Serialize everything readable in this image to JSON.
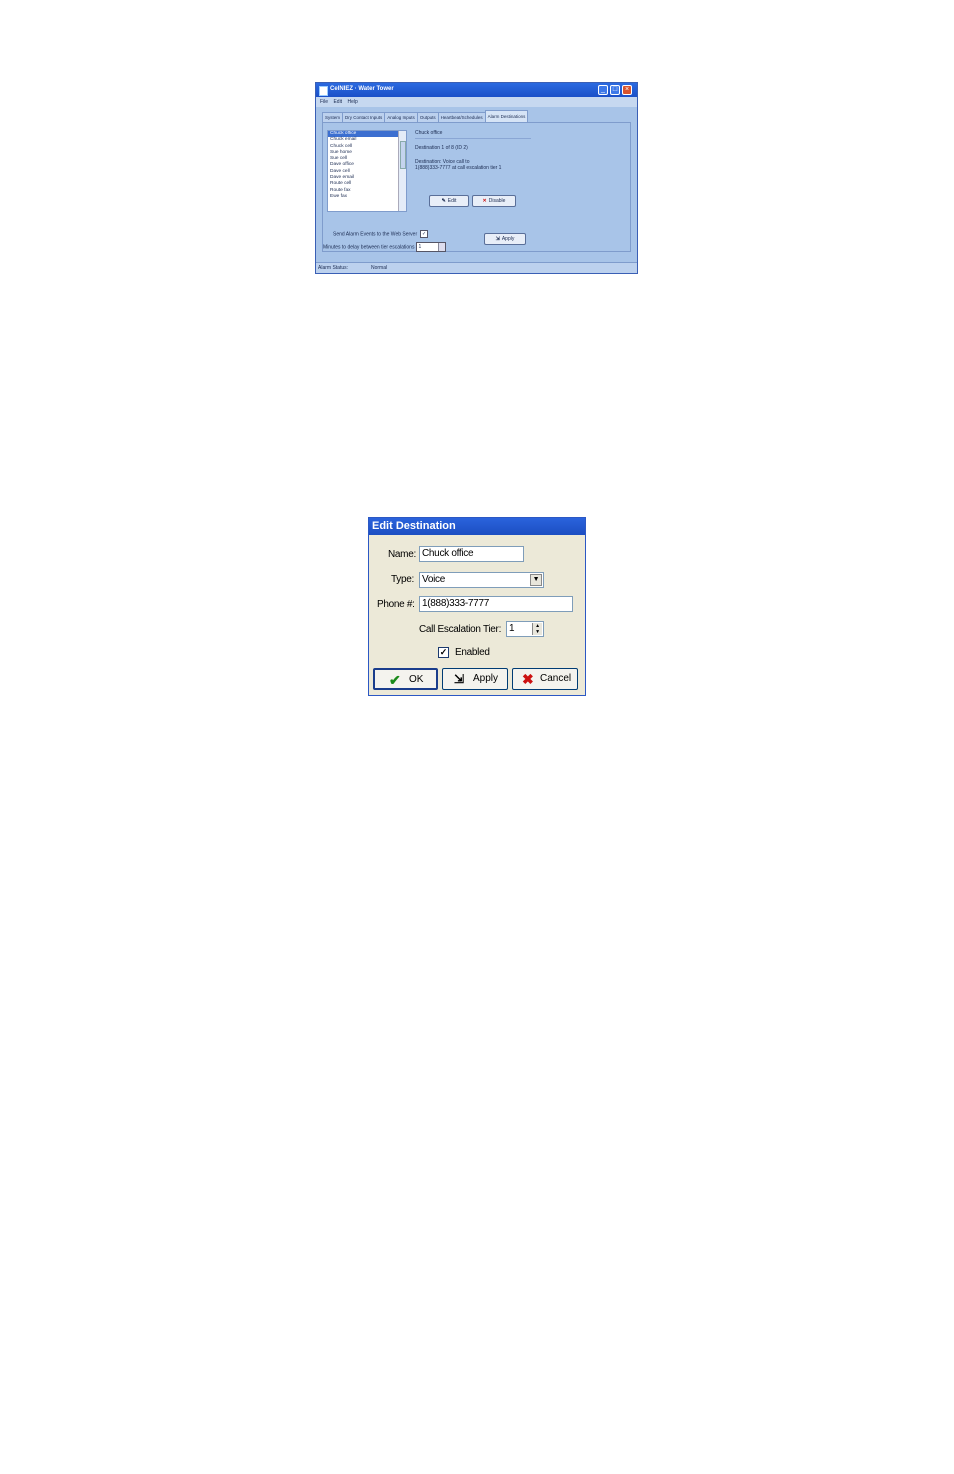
{
  "main_window": {
    "title": "CelNIEZ  ·  Water Tower",
    "title_buttons": [
      "minimize-icon",
      "maximize-icon",
      "close-icon"
    ],
    "menu": [
      "File",
      "Edit",
      "Help"
    ],
    "tabs": [
      "System",
      "Dry Contact Inputs",
      "Analog Inputs",
      "Outputs",
      "Heartbeat/Schedules",
      "Alarm Destinations"
    ],
    "active_tab": "Alarm Destinations",
    "destinations": [
      "Chuck office",
      "Chuck email",
      "Chuck cell",
      "Sue home",
      "Sue cell",
      "Dave office",
      "Dave cell",
      "Dave email",
      "Route cell",
      "Route fax",
      "Ewe fax"
    ],
    "selected_destination": "Chuck office",
    "detail": {
      "name": "Chuck office",
      "position": "Destination 1 of 8 (ID 2)",
      "line1": "Destination: Voice call to",
      "line2": "1(888)333-7777 at call escalation tier 1"
    },
    "edit_button": "Edit",
    "disable_button": "Disable",
    "send_alarm_label": "Send Alarm Events to the Web Server",
    "send_alarm_checked": true,
    "minutes_label": "Minutes to delay between tier escalations",
    "minutes_value": "1",
    "apply_button": "Apply",
    "status": {
      "left": "Alarm Status:",
      "right": "Normal"
    }
  },
  "dialog": {
    "title": "Edit Destination",
    "name_label": "Name:",
    "name_value": "Chuck office",
    "type_label": "Type:",
    "type_value": "Voice",
    "phone_label": "Phone #:",
    "phone_value": "1(888)333-7777",
    "tier_label": "Call Escalation Tier:",
    "tier_value": "1",
    "enabled_label": "Enabled",
    "enabled_checked": true,
    "ok_button": "OK",
    "apply_button": "Apply",
    "cancel_button": "Cancel"
  },
  "colors": {
    "window_bg": "#a8c4e8",
    "titlebar": "#1a4fc8",
    "dialog_bg": "#ece9d8",
    "ok_check": "#1a8a1a",
    "cancel_x": "#cc1111"
  }
}
